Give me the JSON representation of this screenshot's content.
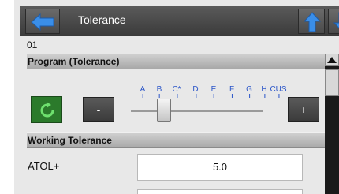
{
  "header": {
    "title": "Tolerance"
  },
  "record": {
    "id": "01"
  },
  "program_section": {
    "title": "Program (Tolerance)"
  },
  "slider": {
    "ticks": [
      "A",
      "B",
      "C*",
      "D",
      "E",
      "F",
      "G",
      "H",
      "CUS"
    ],
    "selected": "C*",
    "minus_label": "-",
    "plus_label": "+"
  },
  "working_section": {
    "title": "Working Tolerance"
  },
  "atol": {
    "label": "ATOL+",
    "value": "5.0"
  },
  "colors": {
    "arrow_blue": "#3a8ee8",
    "reset_green": "#2b7a2b",
    "tick_blue": "#2a55c8"
  },
  "icons": {
    "back": "back-arrow-icon",
    "up": "up-arrow-icon",
    "down": "down-arrow-icon",
    "reset": "refresh-icon"
  }
}
